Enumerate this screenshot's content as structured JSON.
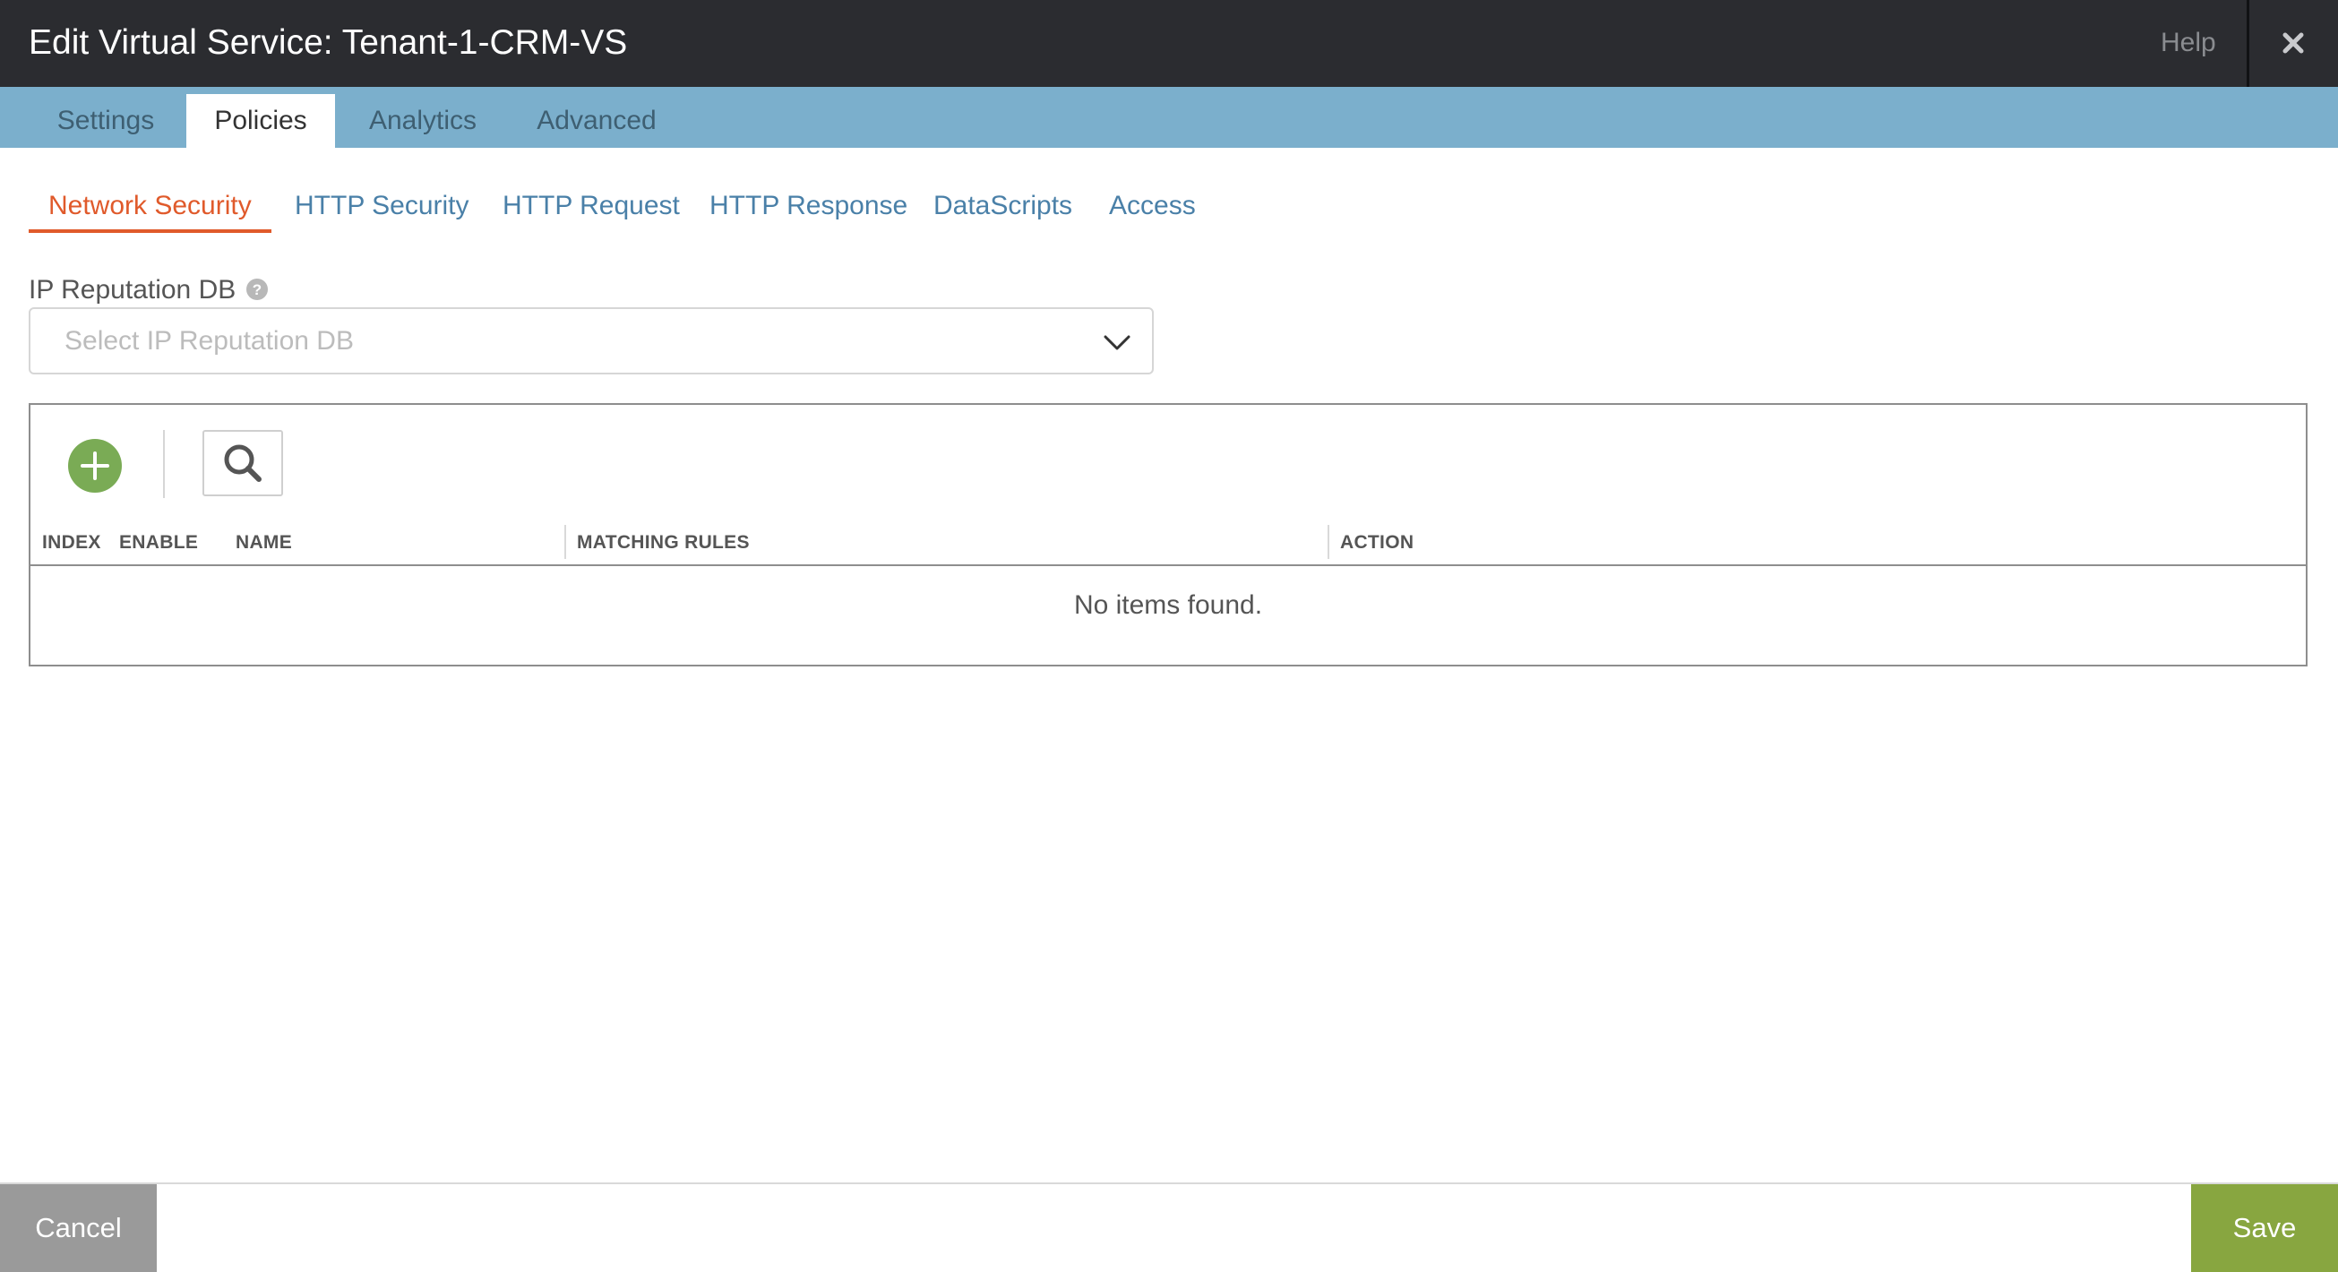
{
  "window": {
    "title": "Edit Virtual Service: Tenant-1-CRM-VS",
    "help_label": "Help",
    "close_icon": "close-icon"
  },
  "tabs": [
    {
      "label": "Settings",
      "active": false
    },
    {
      "label": "Policies",
      "active": true
    },
    {
      "label": "Analytics",
      "active": false
    },
    {
      "label": "Advanced",
      "active": false
    }
  ],
  "subtabs": [
    {
      "label": "Network Security",
      "active": true
    },
    {
      "label": "HTTP Security",
      "active": false
    },
    {
      "label": "HTTP Request",
      "active": false
    },
    {
      "label": "HTTP Response",
      "active": false
    },
    {
      "label": "DataScripts",
      "active": false
    },
    {
      "label": "Access",
      "active": false
    }
  ],
  "ip_reputation": {
    "label": "IP Reputation DB",
    "placeholder": "Select IP Reputation DB",
    "help_icon": "question-circle-icon",
    "chevron_icon": "chevron-down-icon"
  },
  "grid": {
    "add_icon": "plus-circle-icon",
    "search_icon": "search-icon",
    "columns": [
      "INDEX",
      "ENABLE",
      "NAME",
      "MATCHING RULES",
      "ACTION"
    ],
    "empty_message": "No items found."
  },
  "footer": {
    "cancel_label": "Cancel",
    "save_label": "Save"
  },
  "colors": {
    "titlebar": "#2b2c30",
    "tabbar": "#7bafcc",
    "active_subtab": "#e05a2b",
    "link": "#4a80a8",
    "add_button": "#7aab55",
    "save_button": "#88a640",
    "cancel_button": "#9a9a9a"
  }
}
